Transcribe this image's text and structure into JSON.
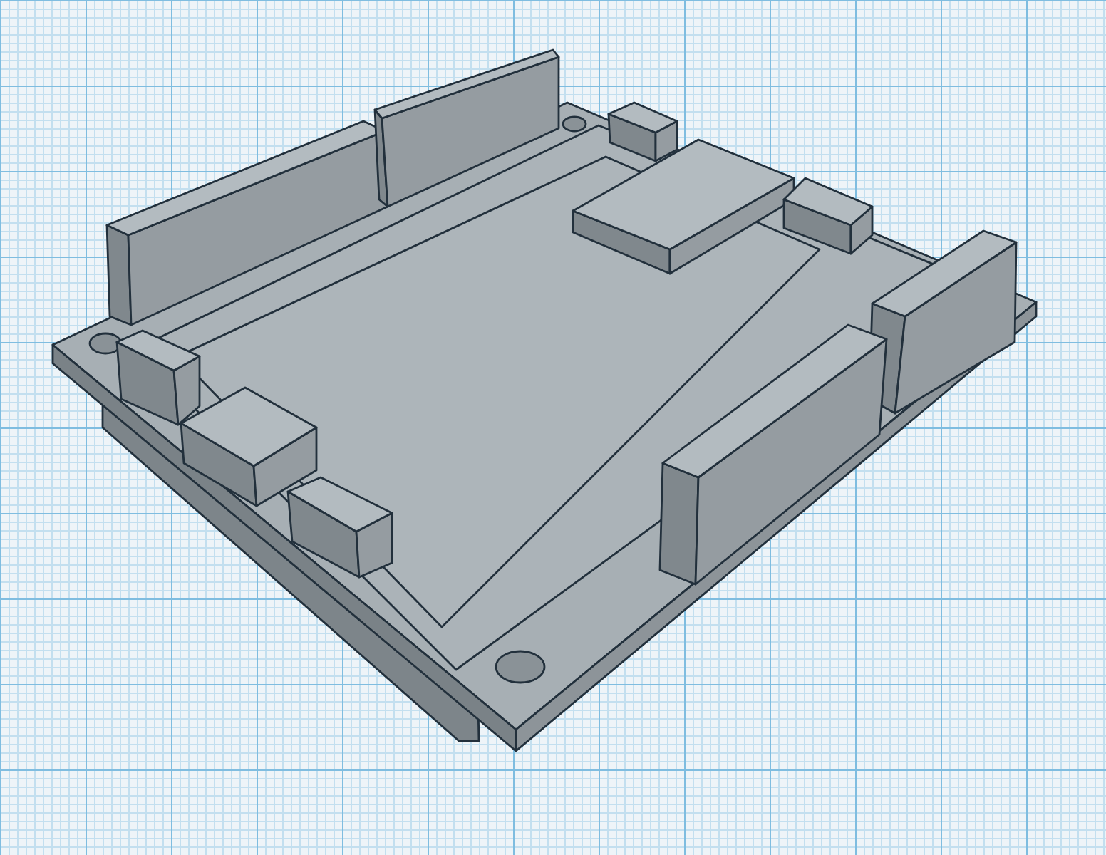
{
  "workplane": {
    "kind": "grid"
  },
  "model": {
    "kind": "circuit-board"
  }
}
